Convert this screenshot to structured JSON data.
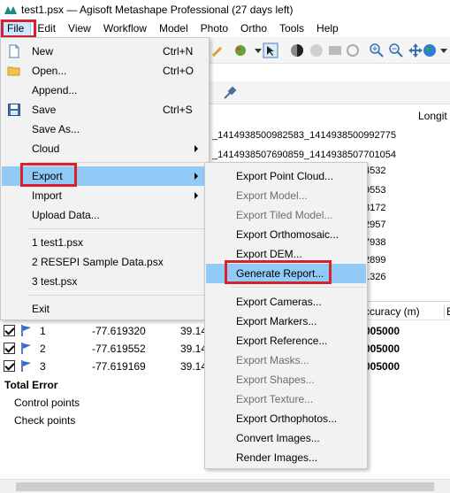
{
  "window": {
    "title": "test1.psx — Agisoft Metashape Professional (27 days left)"
  },
  "menubar": {
    "items": [
      "File",
      "Edit",
      "View",
      "Workflow",
      "Model",
      "Photo",
      "Ortho",
      "Tools",
      "Help"
    ],
    "active": "File"
  },
  "file_menu": {
    "items": [
      {
        "label": "New",
        "shortcut": "Ctrl+N",
        "icon": "new-file-icon"
      },
      {
        "label": "Open...",
        "shortcut": "Ctrl+O",
        "icon": "open-folder-icon"
      },
      {
        "label": "Append...",
        "shortcut": ""
      },
      {
        "label": "Save",
        "shortcut": "Ctrl+S",
        "icon": "save-icon"
      },
      {
        "label": "Save As...",
        "shortcut": ""
      },
      {
        "label": "Cloud",
        "submenu": true
      },
      {
        "label": "Export",
        "submenu": true,
        "highlighted": true
      },
      {
        "label": "Import",
        "submenu": true
      },
      {
        "label": "Upload Data..."
      },
      {
        "label": "1 test1.psx"
      },
      {
        "label": "2 RESEPI Sample Data.psx"
      },
      {
        "label": "3 test.psx"
      },
      {
        "label": "Exit"
      }
    ]
  },
  "export_submenu": {
    "items": [
      {
        "label": "Export Point Cloud...",
        "enabled": true
      },
      {
        "label": "Export Model...",
        "enabled": false
      },
      {
        "label": "Export Tiled Model...",
        "enabled": false
      },
      {
        "label": "Export Orthomosaic...",
        "enabled": true
      },
      {
        "label": "Export DEM...",
        "enabled": true
      },
      {
        "label": "Generate Report...",
        "enabled": true,
        "highlighted": true
      },
      {
        "label": "Export Cameras...",
        "enabled": true
      },
      {
        "label": "Export Markers...",
        "enabled": true
      },
      {
        "label": "Export Reference...",
        "enabled": true
      },
      {
        "label": "Export Masks...",
        "enabled": false
      },
      {
        "label": "Export Shapes...",
        "enabled": false
      },
      {
        "label": "Export Texture...",
        "enabled": false
      },
      {
        "label": "Export Orthophotos...",
        "enabled": true
      },
      {
        "label": "Convert Images...",
        "enabled": true
      },
      {
        "label": "Render Images...",
        "enabled": true
      }
    ]
  },
  "background": {
    "longitude_header": "Longit",
    "accuracy_header": "ccuracy (m)",
    "col_e_header": "E",
    "lines": [
      "_1414938500982583_1414938500992775",
      "_1414938507690859_1414938507701054"
    ],
    "right_values": [
      "4532",
      "9553",
      "8172",
      "2957",
      "7938",
      "2899",
      "1326"
    ]
  },
  "reference": {
    "rows": [
      {
        "label": "1",
        "longitude": "-77.619320",
        "latitude": "39.14",
        "accuracy": "005000"
      },
      {
        "label": "2",
        "longitude": "-77.619552",
        "latitude": "39.14",
        "accuracy": "005000"
      },
      {
        "label": "3",
        "longitude": "-77.619169",
        "latitude": "39.14",
        "accuracy": "005000"
      }
    ],
    "total_error": "Total Error",
    "control_points": "Control points",
    "check_points": "Check points"
  },
  "colors": {
    "highlight": "#91c9f7",
    "annotation_red": "#d9202b",
    "menu_bg": "#f2f2f2",
    "disabled_text": "#6d6d6d"
  }
}
